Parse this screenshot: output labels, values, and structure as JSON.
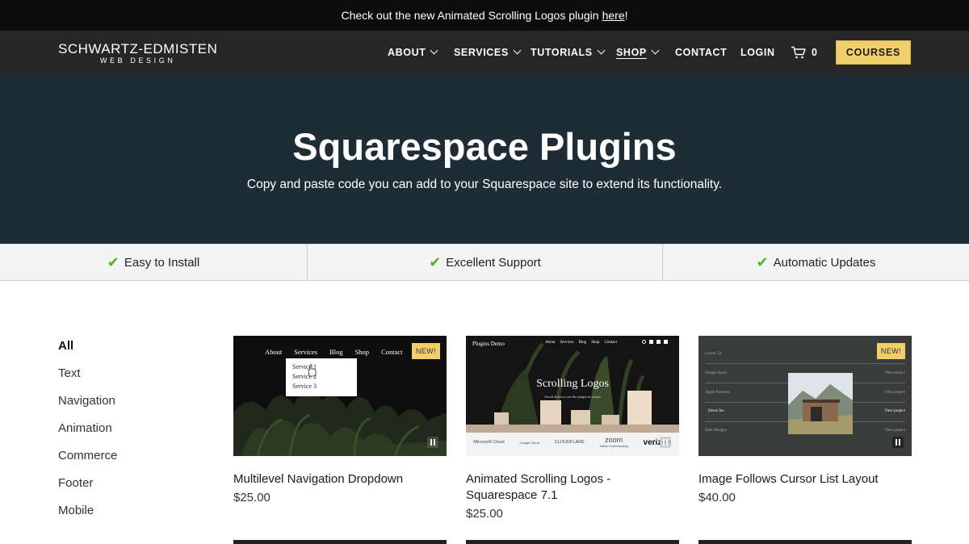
{
  "announcement": {
    "text": "Check out the new Animated Scrolling Logos plugin",
    "link": "here",
    "suffix": "!"
  },
  "nav": {
    "logo_line1": "SCHWARTZ-EDMISTEN",
    "logo_line2": "WEB DESIGN",
    "items": [
      {
        "label": "ABOUT",
        "dropdown": true
      },
      {
        "label": "SERVICES",
        "dropdown": true
      },
      {
        "label": "TUTORIALS",
        "dropdown": true
      },
      {
        "label": "SHOP",
        "dropdown": true
      },
      {
        "label": "CONTACT",
        "dropdown": false
      },
      {
        "label": "LOGIN",
        "dropdown": false
      }
    ],
    "cart_count": "0",
    "cta": "COURSES"
  },
  "hero": {
    "title": "Squarespace Plugins",
    "subtitle": "Copy and paste code you can add to your Squarespace site to extend its functionality."
  },
  "features": [
    {
      "check": "✔",
      "label": "Easy to Install"
    },
    {
      "check": "✔",
      "label": "Excellent Support"
    },
    {
      "check": "✔",
      "label": "Automatic Updates"
    }
  ],
  "categories": [
    "All",
    "Text",
    "Navigation",
    "Animation",
    "Commerce",
    "Footer",
    "Mobile"
  ],
  "products": [
    {
      "title": "Multilevel Navigation Dropdown",
      "price": "$25.00",
      "badge": "NEW!",
      "thumb_nav": [
        "About",
        "Services",
        "Blog",
        "Shop",
        "Contact"
      ],
      "thumb_menu": [
        "Service 1",
        "Service 2",
        "Service 3"
      ]
    },
    {
      "title": "Animated Scrolling Logos - Squarespace 7.1",
      "price": "$25.00",
      "badge": "",
      "thumb_site": "Plugins Demo",
      "thumb_nav": [
        "About",
        "Services",
        "Blog",
        "Shop",
        "Contact"
      ],
      "thumb_heading": "Scrolling Logos",
      "thumb_sub": "Scroll down to see the plugin in action",
      "thumb_logos": [
        "Microsoft Cloud",
        "Google Cloud",
        "CLOUDFLARE",
        "zoom",
        "Video Conferencing",
        "verizon"
      ]
    },
    {
      "title": "Image Follows Cursor List Layout",
      "price": "$40.00",
      "badge": "NEW!",
      "thumb_rows": [
        {
          "name": "Lorem Co.",
          "link": ""
        },
        {
          "name": "Design Space",
          "link": "View project"
        },
        {
          "name": "Apple Interiors",
          "link": "View project"
        },
        {
          "name": "Decor Inc",
          "link": "View project"
        },
        {
          "name": "Beth Designs",
          "link": "View project"
        }
      ]
    }
  ],
  "colors": {
    "nav_bg": "#262626",
    "hero_bg": "#1e2d35",
    "accent": "#f1cf6a",
    "check": "#52b52e"
  }
}
